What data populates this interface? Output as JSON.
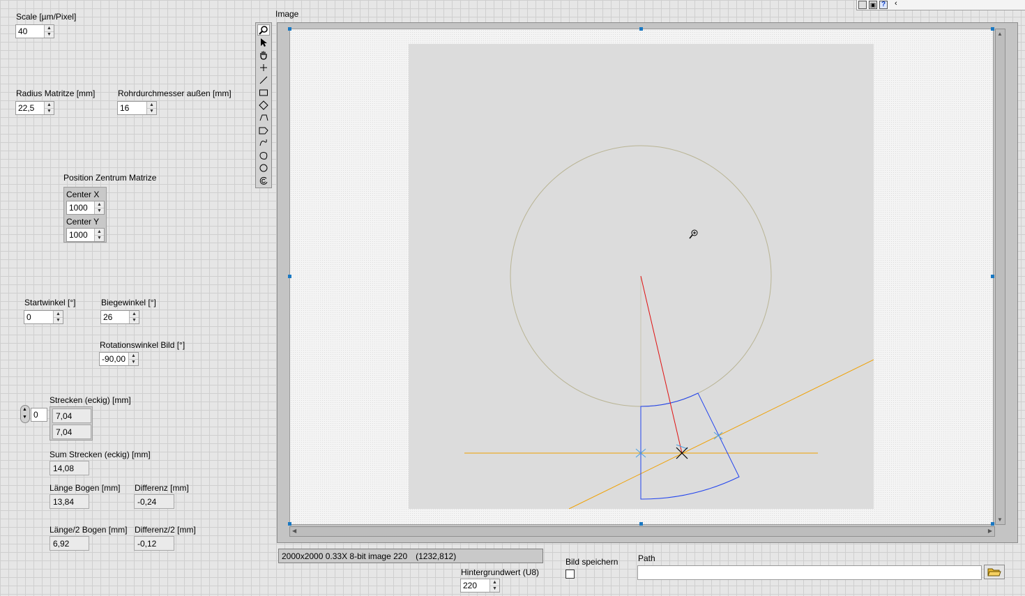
{
  "controls": {
    "scale": {
      "label": "Scale [µm/Pixel]",
      "value": "40"
    },
    "radius_matrize": {
      "label": "Radius Matritze [mm]",
      "value": "22,5"
    },
    "rohrdurchmesser": {
      "label": "Rohrdurchmesser außen [mm]",
      "value": "16"
    },
    "position": {
      "label": "Position Zentrum Matrize",
      "center_x_label": "Center X",
      "center_x": "1000",
      "center_y_label": "Center Y",
      "center_y": "1000"
    },
    "startwinkel": {
      "label": "Startwinkel [°]",
      "value": "0"
    },
    "biegewinkel": {
      "label": "Biegewinkel [°]",
      "value": "26"
    },
    "rotationswinkel": {
      "label": "Rotationswinkel Bild [°]",
      "value": "-90,00"
    }
  },
  "indicators": {
    "strecken": {
      "label": "Strecken (eckig) [mm]",
      "index": "0",
      "values": [
        "7,04",
        "7,04"
      ]
    },
    "sum_strecken": {
      "label": "Sum Strecken (eckig) [mm]",
      "value": "14,08"
    },
    "laenge_bogen": {
      "label": "Länge Bogen [mm]",
      "value": "13,84"
    },
    "differenz": {
      "label": "Differenz [mm]",
      "value": "-0,24"
    },
    "laenge_halb": {
      "label": "Länge/2  Bogen [mm]",
      "value": "6,92"
    },
    "differenz_halb": {
      "label": "Differenz/2 [mm]",
      "value": "-0,12"
    }
  },
  "image_display": {
    "label": "Image",
    "status": {
      "info": "2000x2000 0.33X 8-bit image 220",
      "coords": "(1232,812)"
    },
    "tools": [
      "zoom-tool-icon",
      "pointer-tool-icon",
      "pan-tool-icon",
      "point-tool-icon",
      "line-tool-icon",
      "rectangle-tool-icon",
      "rotated-rectangle-tool-icon",
      "polygon-tool-icon",
      "broken-line-tool-icon",
      "freehand-line-tool-icon",
      "freehand-region-tool-icon",
      "oval-tool-icon",
      "annulus-tool-icon"
    ]
  },
  "bottom": {
    "hintergrund": {
      "label": "Hintergrundwert (U8)",
      "value": "220"
    },
    "bild_speichern": {
      "label": "Bild speichern",
      "checked": false
    },
    "path": {
      "label": "Path",
      "value": ""
    }
  },
  "overlay_colors": {
    "circle": "#b9b494",
    "bend": "#2244ee",
    "radius": "#e01010",
    "guide": "#f0a000"
  }
}
